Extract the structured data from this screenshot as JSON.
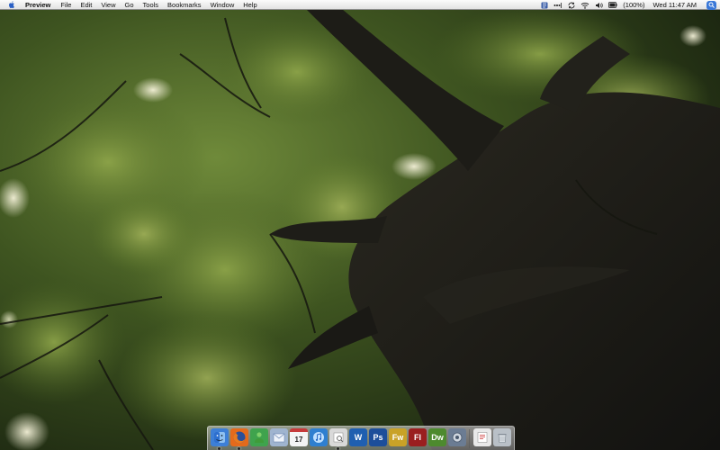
{
  "menubar": {
    "app_name": "Preview",
    "menus": [
      "File",
      "Edit",
      "View",
      "Go",
      "Tools",
      "Bookmarks",
      "Window",
      "Help"
    ],
    "battery": "(100%)",
    "clock": "Wed 11:47 AM"
  },
  "dock": {
    "apps": [
      {
        "name": "finder-icon",
        "color": "#3d7fd6"
      },
      {
        "name": "firefox-icon",
        "color": "#e46a1c"
      },
      {
        "name": "ichat-icon",
        "color": "#3fa34d"
      },
      {
        "name": "mail-icon",
        "color": "#9fb4cf"
      },
      {
        "name": "ical-icon",
        "color": "#c63a3a",
        "label": "17"
      },
      {
        "name": "itunes-icon",
        "color": "#2f7fd0"
      },
      {
        "name": "preview-icon",
        "color": "#d9d9d9"
      },
      {
        "name": "word-icon",
        "color": "#1f5fb0",
        "label": "W"
      },
      {
        "name": "photoshop-icon",
        "color": "#1d4e9a",
        "label": "Ps"
      },
      {
        "name": "fireworks-icon",
        "color": "#c9a227",
        "label": "Fw"
      },
      {
        "name": "flash-icon",
        "color": "#9a1f1f",
        "label": "Fl"
      },
      {
        "name": "dreamweaver-icon",
        "color": "#4d8a2e",
        "label": "Dw"
      },
      {
        "name": "system-preferences-icon",
        "color": "#6b7c93"
      }
    ],
    "docs": [
      {
        "name": "document-icon",
        "color": "#e9e9e9"
      },
      {
        "name": "trash-icon",
        "color": "#b9c0c7"
      }
    ]
  }
}
